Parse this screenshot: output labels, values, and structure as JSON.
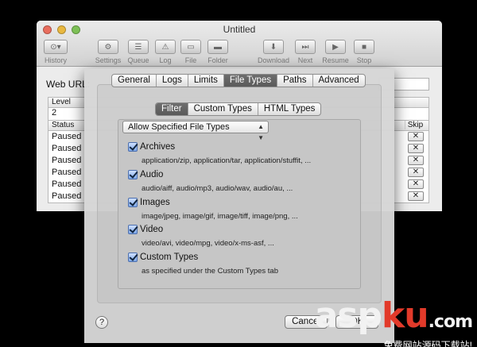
{
  "window": {
    "title": "Untitled"
  },
  "toolbar": {
    "buttons": [
      {
        "label": "History",
        "icon": "history-icon",
        "glyph": "⊙▾"
      },
      {
        "label": "Settings",
        "icon": "gear-icon",
        "glyph": "⚙"
      },
      {
        "label": "Queue",
        "icon": "queue-icon",
        "glyph": "☰"
      },
      {
        "label": "Log",
        "icon": "warning-icon",
        "glyph": "⚠"
      },
      {
        "label": "File",
        "icon": "file-icon",
        "glyph": "▭"
      },
      {
        "label": "Folder",
        "icon": "folder-icon",
        "glyph": "▬"
      },
      {
        "label": "Download",
        "icon": "download-icon",
        "glyph": "⬇"
      },
      {
        "label": "Next",
        "icon": "next-icon",
        "glyph": "⏭"
      },
      {
        "label": "Resume",
        "icon": "play-icon",
        "glyph": "▶"
      },
      {
        "label": "Stop",
        "icon": "stop-icon",
        "glyph": "■"
      }
    ]
  },
  "main": {
    "web_url_label": "Web URL:",
    "level_header": "Level",
    "level_value": "2",
    "status_header": "Status",
    "skip_header": "Skip",
    "rows": [
      {
        "status": "Paused",
        "skip": "✕"
      },
      {
        "status": "Paused",
        "skip": "✕"
      },
      {
        "status": "Paused",
        "skip": "✕"
      },
      {
        "status": "Paused",
        "skip": "✕"
      },
      {
        "status": "Paused",
        "skip": "✕"
      },
      {
        "status": "Paused",
        "skip": "✕"
      }
    ]
  },
  "prefs": {
    "tabs": [
      "General",
      "Logs",
      "Limits",
      "File Types",
      "Paths",
      "Advanced"
    ],
    "selected_tab": "File Types",
    "subtabs": [
      "Filter",
      "Custom Types",
      "HTML Types"
    ],
    "selected_subtab": "Filter",
    "filter_mode": "Allow Specified File Types",
    "options": [
      {
        "name": "Archives",
        "checked": true,
        "desc": "application/zip, application/tar, application/stuffit, ..."
      },
      {
        "name": "Audio",
        "checked": true,
        "desc": "audio/aiff, audio/mp3, audio/wav, audio/au, ..."
      },
      {
        "name": "Images",
        "checked": true,
        "desc": "image/jpeg, image/gif, image/tiff, image/png, ..."
      },
      {
        "name": "Video",
        "checked": true,
        "desc": "video/avi, video/mpg, video/x-ms-asf, ..."
      },
      {
        "name": "Custom Types",
        "checked": true,
        "desc": "as specified under the Custom Types tab"
      }
    ],
    "help_label": "?",
    "cancel_label": "Cancel",
    "ok_label": "OK"
  },
  "watermark": {
    "logo_part1": "asp",
    "logo_part2": "ku",
    "logo_part3": ".com",
    "subtitle": "免费网站源码下载站!"
  },
  "colors": {
    "tab_selected_bg": "#5f5f5f",
    "checkbox_blue": "#7ea8e8",
    "watermark_red": "#e23a2a"
  }
}
